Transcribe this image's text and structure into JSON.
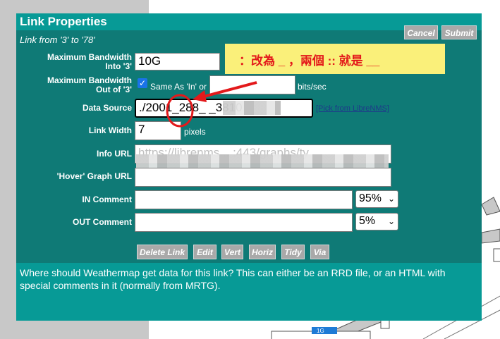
{
  "dialog": {
    "title": "Link Properties",
    "subtitle": "Link from '3' to '78'",
    "cancel_label": "Cancel",
    "submit_label": "Submit"
  },
  "fields": {
    "bw_in_label_1": "Maximum Bandwidth",
    "bw_in_label_2": "Into '3'",
    "bw_in_value": "10G",
    "bw_out_label_1": "Maximum Bandwidth",
    "bw_out_label_2": "Out of '3'",
    "same_as_text": "Same As 'In' or",
    "bits_unit": "bits/sec",
    "data_source_label": "Data Source",
    "data_source_value": "./2001_288_ _3810",
    "pick_link": "[Pick from LibreNMS]",
    "link_width_label": "Link Width",
    "link_width_value": "7",
    "pixels_unit": "pixels",
    "info_url_label": "Info URL",
    "info_url_value": "https://librenms... :443/graphs/ty",
    "hover_url_label": "'Hover' Graph URL",
    "in_comment_label": "IN Comment",
    "in_pos_value": "95%",
    "out_comment_label": "OUT Comment",
    "out_pos_value": "5%"
  },
  "buttons": {
    "delete_link": "Delete Link",
    "edit": "Edit",
    "vert": "Vert",
    "horiz": "Horiz",
    "tidy": "Tidy",
    "via": "Via"
  },
  "help_text": "Where should Weathermap get data for this link? This can either be an RRD file, or an HTML with special comments in it (normally from MRTG).",
  "annotation": {
    "note_text": "：改為 _ ，兩個 :: 就是 __",
    "color": "#e3191b"
  },
  "background": {
    "node_label": "1G"
  }
}
